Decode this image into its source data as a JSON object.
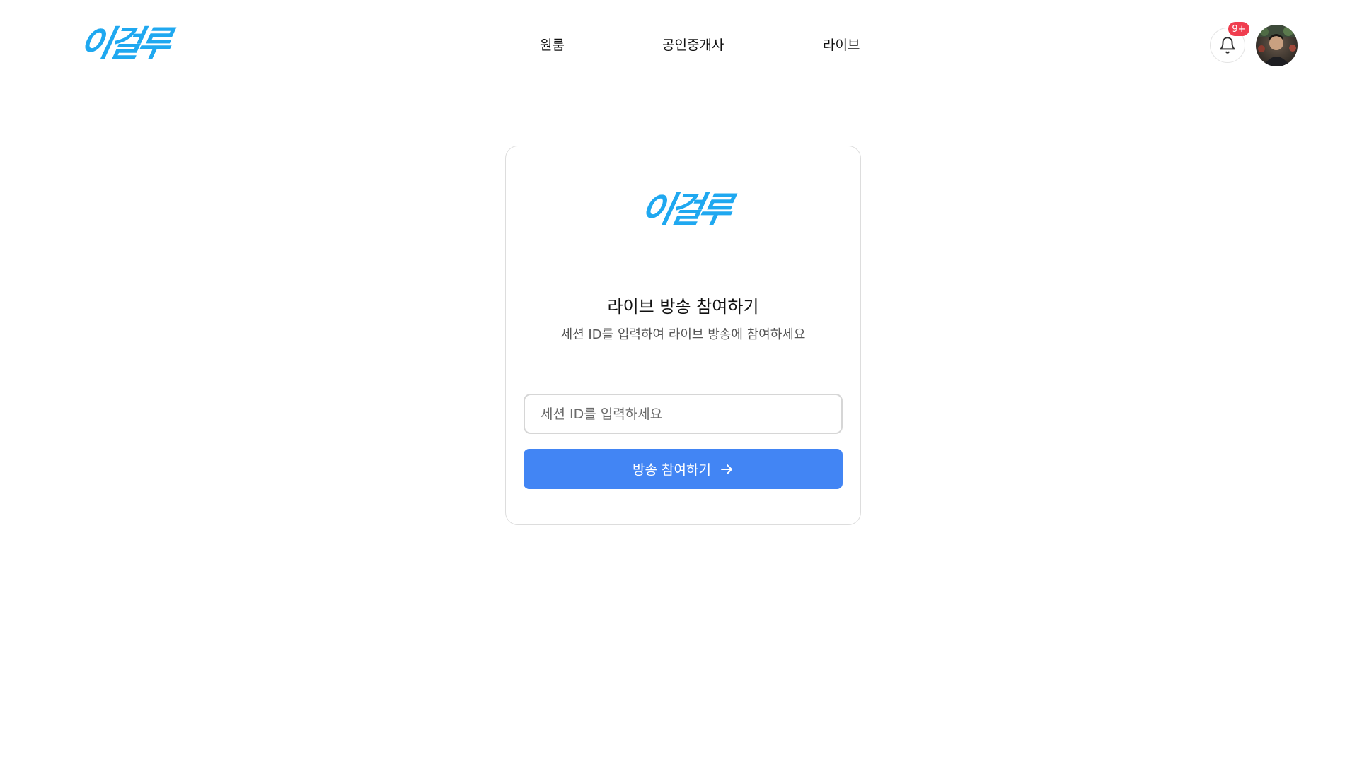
{
  "brand": {
    "logo_text": "이걸루",
    "color": "#1fa8f0"
  },
  "nav": {
    "items": [
      {
        "label": "원룸"
      },
      {
        "label": "공인중개사"
      },
      {
        "label": "라이브"
      }
    ]
  },
  "header": {
    "notification_badge": "9+",
    "bell_icon": "bell-icon",
    "badge_color": "#f03e4f"
  },
  "card": {
    "logo_text": "이걸루",
    "title": "라이브 방송 참여하기",
    "subtitle": "세션 ID를 입력하여 라이브 방송에 참여하세요",
    "input": {
      "value": "",
      "placeholder": "세션 ID를 입력하세요"
    },
    "button": {
      "label": "방송 참여하기",
      "icon": "arrow-right-icon",
      "color": "#4285f4"
    }
  }
}
